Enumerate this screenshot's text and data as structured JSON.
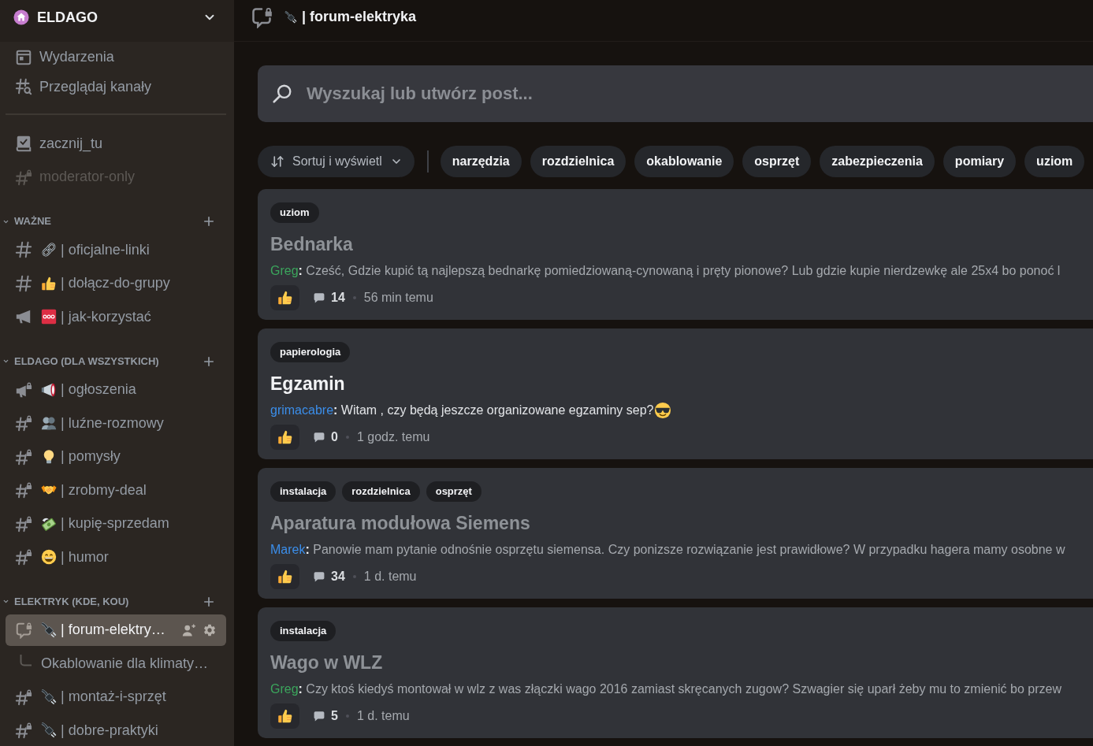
{
  "server": {
    "name": "ELDAGO"
  },
  "sidebar": {
    "top_items": [
      {
        "kind": "events",
        "label": "Wydarzenia"
      },
      {
        "kind": "browse",
        "label": "Przeglądaj kanały"
      }
    ],
    "channels": [
      {
        "kind": "rules",
        "name": "zacznij_tu",
        "muted": false,
        "selected": false
      },
      {
        "kind": "text-locked",
        "name": "moderator-only",
        "muted": true,
        "selected": false
      }
    ],
    "categories": [
      {
        "name": "WAŻNE",
        "expanded": true,
        "channels": [
          {
            "kind": "text",
            "emoji": {
              "kind": "link"
            },
            "name": "| oficjalne-linki",
            "muted": false,
            "selected": false
          },
          {
            "kind": "text",
            "emoji": {
              "kind": "thumbs-up"
            },
            "name": "| dołącz-do-grupy",
            "muted": false,
            "selected": false
          },
          {
            "kind": "announcement",
            "emoji": {
              "kind": "sos"
            },
            "name": "| jak-korzystać",
            "muted": false,
            "selected": false
          }
        ]
      },
      {
        "name": "ELDAGO (DLA WSZYSTKICH)",
        "expanded": true,
        "channels": [
          {
            "kind": "announcement-locked",
            "emoji": {
              "kind": "loudspeaker"
            },
            "name": "| ogłoszenia",
            "muted": false,
            "selected": false
          },
          {
            "kind": "text-locked",
            "emoji": {
              "kind": "people"
            },
            "name": "| luźne-rozmowy",
            "muted": false,
            "selected": false
          },
          {
            "kind": "text-locked",
            "emoji": {
              "kind": "bulb"
            },
            "name": "| pomysły",
            "muted": false,
            "selected": false
          },
          {
            "kind": "text-locked",
            "emoji": {
              "kind": "handshake"
            },
            "name": "| zrobmy-deal",
            "muted": false,
            "selected": false
          },
          {
            "kind": "text-locked",
            "emoji": {
              "kind": "money"
            },
            "name": "| kupię-sprzedam",
            "muted": false,
            "selected": false
          },
          {
            "kind": "text-locked",
            "emoji": {
              "kind": "grin"
            },
            "name": "| humor",
            "muted": false,
            "selected": false
          }
        ]
      },
      {
        "name": "ELEKTRYK (KDE, KOU)",
        "expanded": true,
        "channels": [
          {
            "kind": "forum-locked",
            "emoji": {
              "kind": "plug"
            },
            "name": "| forum-elektry…",
            "muted": false,
            "selected": true,
            "children": [
              {
                "name": "Okablowanie dla klimaty…"
              }
            ]
          },
          {
            "kind": "text-locked",
            "emoji": {
              "kind": "plug"
            },
            "name": "| montaż-i-sprzęt",
            "muted": false,
            "selected": false
          },
          {
            "kind": "text-locked",
            "emoji": {
              "kind": "plug"
            },
            "name": "| dobre-praktyki",
            "muted": false,
            "selected": false
          }
        ]
      }
    ]
  },
  "channel_header": {
    "kind": "forum-locked",
    "emoji": {
      "kind": "plug"
    },
    "title": "| forum-elektryka"
  },
  "search": {
    "placeholder": "Wyszukaj lub utwórz post..."
  },
  "sort": {
    "label": "Sortuj i wyświetl"
  },
  "filter_tags": [
    {
      "label": "narzędzia",
      "selected": false
    },
    {
      "label": "rozdzielnica",
      "selected": false
    },
    {
      "label": "okablowanie",
      "selected": false
    },
    {
      "label": "osprzęt",
      "selected": false
    },
    {
      "label": "zabezpieczenia",
      "selected": false
    },
    {
      "label": "pomiary",
      "selected": false
    },
    {
      "label": "uziom",
      "selected": false
    }
  ],
  "posts": [
    {
      "tags": [
        "uziom"
      ],
      "title": "Bednarka",
      "unread": false,
      "author": {
        "name": "Greg",
        "color": "#3ba55c"
      },
      "body": "**:** Cześć, Gdzie kupić tą najlepszą bednarkę pomiedziowaną-cynowaną i pręty pionowe? Lub gdzie kupie nierdzewkę ale 25x4 bo ponoć l",
      "comments": "14",
      "time": "56 min temu"
    },
    {
      "tags": [
        "papierologia"
      ],
      "title": "Egzamin",
      "unread": true,
      "author": {
        "name": "grimacabre",
        "color": "#3b8eea"
      },
      "body": "**:** Witam , czy będą jeszcze organizowane egzaminy sep?",
      "emoji": {
        "kind": "sunglasses"
      },
      "comments": "0",
      "time": "1 godz. temu"
    },
    {
      "tags": [
        "instalacja",
        "rozdzielnica",
        "osprzęt"
      ],
      "title": "Aparatura modułowa Siemens",
      "unread": false,
      "author": {
        "name": "Marek",
        "color": "#3b8eea"
      },
      "body": "**:** Panowie mam pytanie odnośnie osprzętu siemensa. Czy ponizsze rozwiązanie jest prawidłowe? W przypadku hagera mamy osobne w",
      "comments": "34",
      "time": "1 d. temu"
    },
    {
      "tags": [
        "instalacja"
      ],
      "title": "Wago w WLZ",
      "unread": false,
      "author": {
        "name": "Greg",
        "color": "#3ba55c"
      },
      "body": "**:** Czy ktoś kiedyś montował w wlz z was złączki wago 2016 zamiast skręcanych zugow? Szwagier się uparł żeby mu to zmienić bo przew",
      "comments": "5",
      "time": "1 d. temu"
    }
  ]
}
